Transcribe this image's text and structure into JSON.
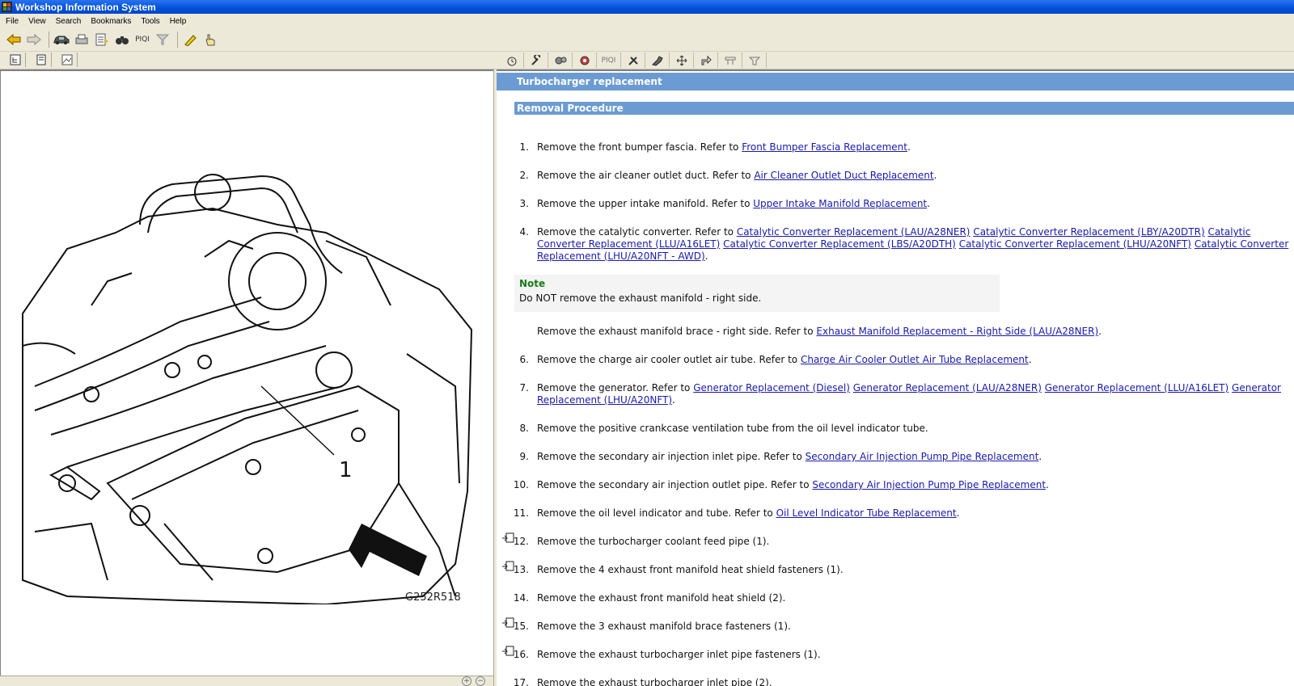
{
  "window": {
    "title": "Workshop Information System"
  },
  "menu": [
    "File",
    "View",
    "Search",
    "Bookmarks",
    "Tools",
    "Help"
  ],
  "toolbar": {
    "piqi_label": "PIQI"
  },
  "righttools": {
    "piqi_label": "PIQI"
  },
  "figure": {
    "code": "G252R518",
    "callout": "1"
  },
  "document": {
    "title": "Turbocharger replacement",
    "section": "Removal Procedure",
    "note": {
      "heading": "Note",
      "text": "Do NOT remove the exhaust manifold - right side."
    },
    "steps": [
      {
        "num": "1.",
        "text": "Remove the front bumper fascia. Refer to ",
        "links": [
          "Front Bumper Fascia Replacement"
        ],
        "tail": "."
      },
      {
        "num": "2.",
        "text": "Remove the air cleaner outlet duct. Refer to ",
        "links": [
          "Air Cleaner Outlet Duct Replacement"
        ],
        "tail": "."
      },
      {
        "num": "3.",
        "text": "Remove the upper intake manifold. Refer to ",
        "links": [
          "Upper Intake Manifold Replacement"
        ],
        "tail": "."
      },
      {
        "num": "4.",
        "text": "Remove the catalytic converter. Refer to ",
        "links": [
          "Catalytic Converter Replacement (LAU/A28NER)",
          "Catalytic Converter Replacement (LBY/A20DTR)",
          "Catalytic Converter Replacement (LLU/A16LET)",
          "Catalytic Converter Replacement (LBS/A20DTH)",
          "Catalytic Converter Replacement (LHU/A20NFT)",
          "Catalytic Converter Replacement (LHU/A20NFT - AWD)"
        ],
        "tail": "."
      },
      {
        "num": "",
        "text": "Remove the exhaust manifold brace - right side. Refer to ",
        "links": [
          "Exhaust Manifold Replacement - Right Side (LAU/A28NER)"
        ],
        "tail": "."
      },
      {
        "num": "6.",
        "text": "Remove the charge air cooler outlet air tube. Refer to ",
        "links": [
          "Charge Air Cooler Outlet Air Tube Replacement"
        ],
        "tail": "."
      },
      {
        "num": "7.",
        "text": "Remove the generator. Refer to ",
        "links": [
          "Generator Replacement (Diesel)",
          "Generator Replacement (LAU/A28NER)",
          "Generator Replacement (LLU/A16LET)",
          "Generator Replacement (LHU/A20NFT)"
        ],
        "tail": "."
      },
      {
        "num": "8.",
        "text": "Remove the positive crankcase ventilation tube from the oil level indicator tube.",
        "links": [],
        "tail": ""
      },
      {
        "num": "9.",
        "text": "Remove the secondary air injection inlet pipe. Refer to ",
        "links": [
          "Secondary Air Injection Pump Pipe Replacement"
        ],
        "tail": "."
      },
      {
        "num": "10.",
        "text": "Remove the secondary air injection outlet pipe. Refer to ",
        "links": [
          "Secondary Air Injection Pump Pipe Replacement"
        ],
        "tail": "."
      },
      {
        "num": "11.",
        "text": "Remove the oil level indicator and tube. Refer to ",
        "links": [
          "Oil Level Indicator Tube Replacement"
        ],
        "tail": "."
      },
      {
        "num": "12.",
        "text": "Remove the turbocharger coolant feed pipe (1).",
        "links": [],
        "tail": "",
        "marker": true
      },
      {
        "num": "13.",
        "text": "Remove the 4 exhaust front manifold heat shield fasteners (1).",
        "links": [],
        "tail": "",
        "marker": true
      },
      {
        "num": "14.",
        "text": "Remove the exhaust front manifold heat shield (2).",
        "links": [],
        "tail": ""
      },
      {
        "num": "15.",
        "text": "Remove the 3 exhaust manifold brace fasteners (1).",
        "links": [],
        "tail": "",
        "marker": true
      },
      {
        "num": "16.",
        "text": "Remove the exhaust turbocharger inlet pipe fasteners (1).",
        "links": [],
        "tail": "",
        "marker": true
      },
      {
        "num": "17.",
        "text": "Remove the exhaust turbocharger inlet pipe (2).",
        "links": [],
        "tail": ""
      }
    ]
  }
}
